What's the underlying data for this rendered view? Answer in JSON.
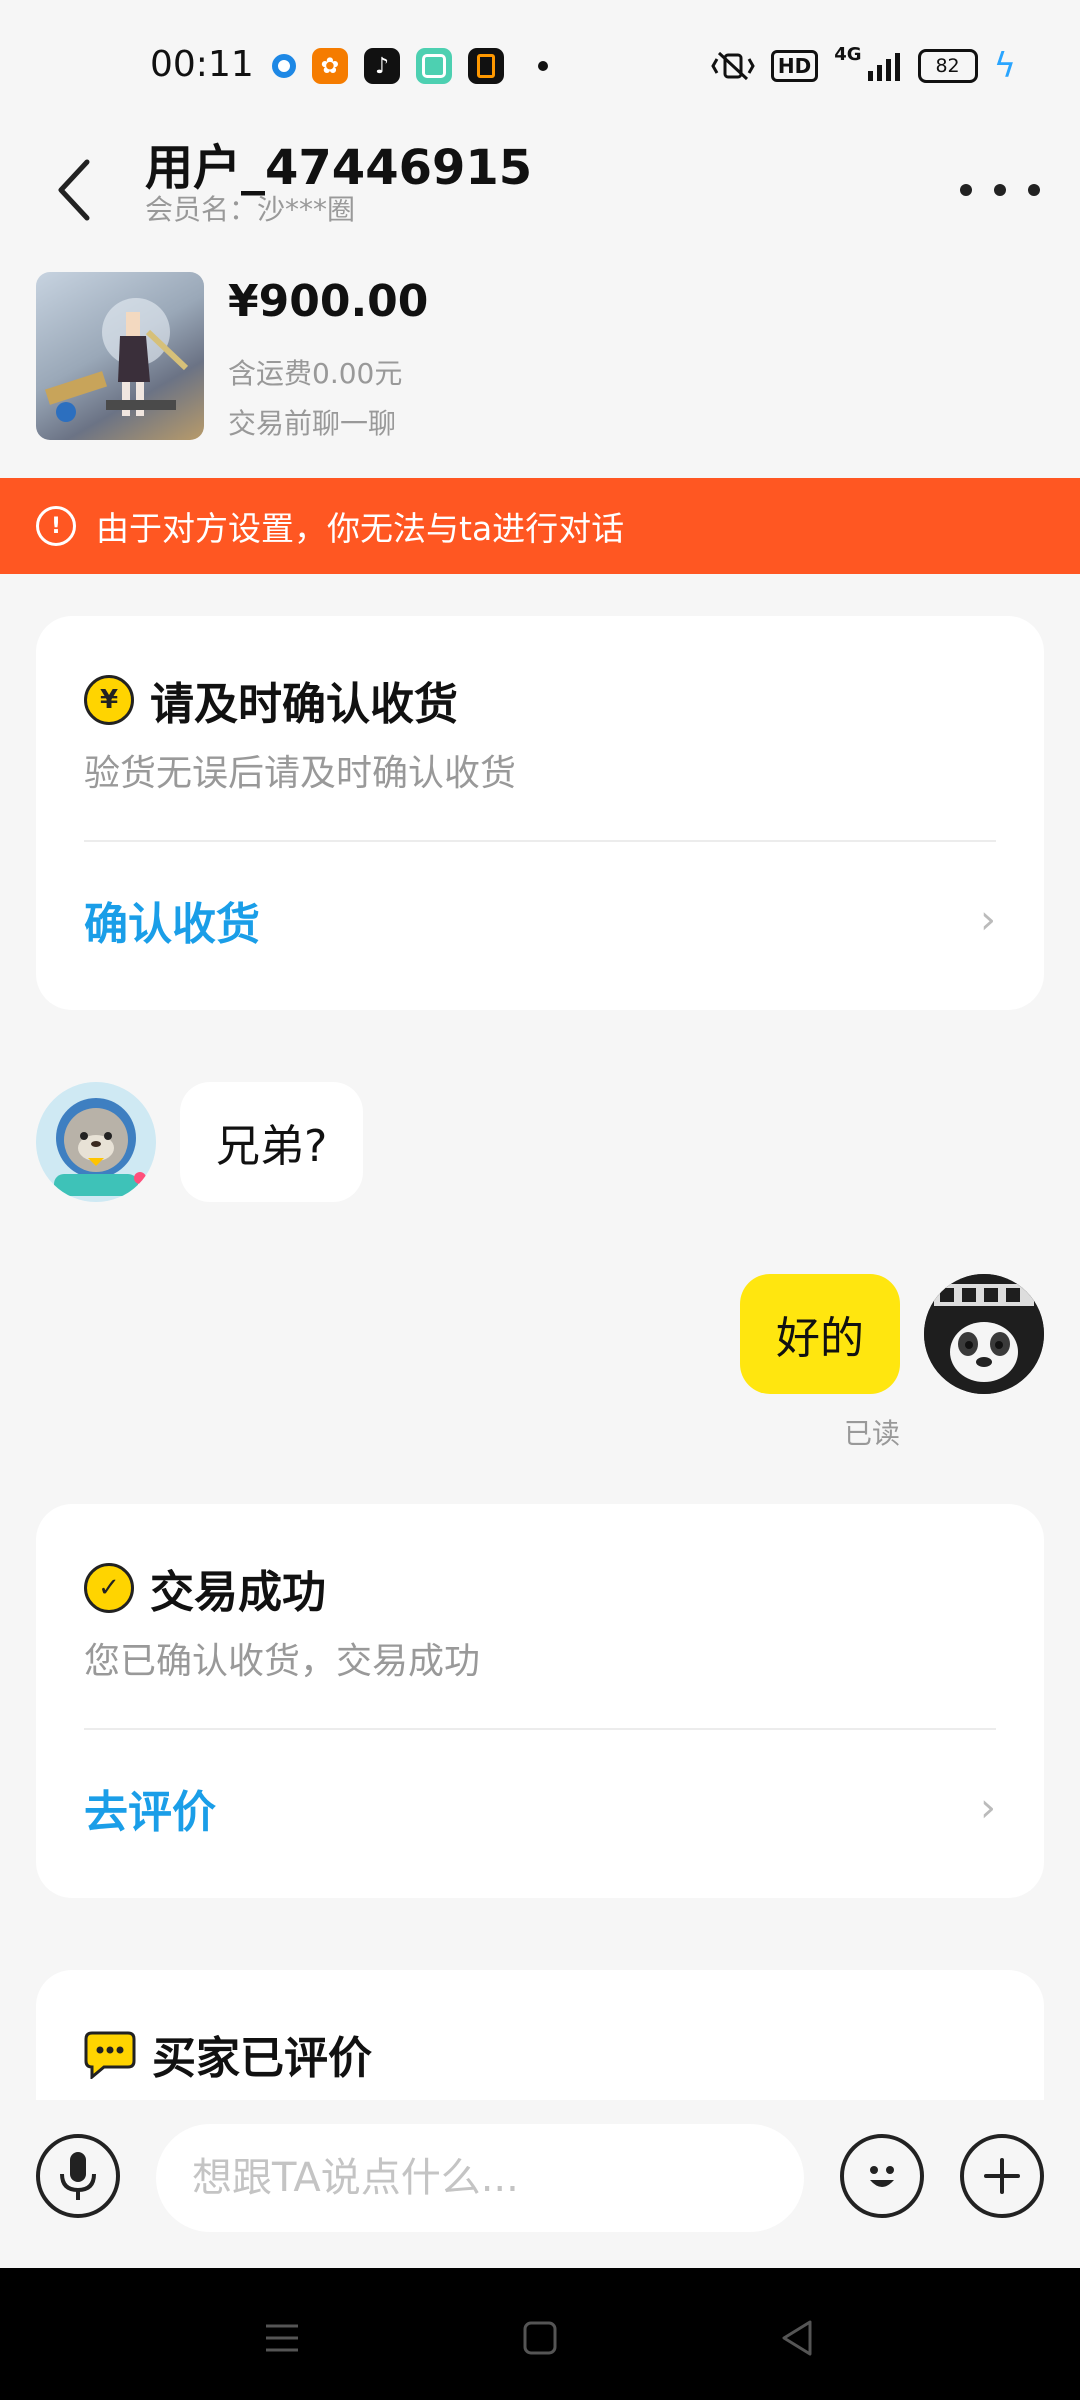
{
  "status_bar": {
    "time": "00:11",
    "network": "4G",
    "hd": "HD",
    "battery": "82"
  },
  "header": {
    "title": "用户_47446915",
    "member_name": "会员名：沙***圈"
  },
  "product": {
    "price": "¥900.00",
    "shipping": "含运费0.00元",
    "chat_hint": "交易前聊一聊"
  },
  "banner": {
    "text": "由于对方设置，你无法与ta进行对话"
  },
  "cards": {
    "confirm": {
      "icon": "yuan-coin-icon",
      "icon_glyph": "¥",
      "title": "请及时确认收货",
      "desc": "验货无误后请及时确认收货",
      "action": "确认收货"
    },
    "success": {
      "icon": "check-circle-icon",
      "icon_glyph": "✓",
      "title": "交易成功",
      "desc": "您已确认收货，交易成功",
      "action": "去评价"
    },
    "reviewed": {
      "icon": "chat-bubble-icon",
      "title": "买家已评价"
    }
  },
  "messages": {
    "incoming": "兄弟?",
    "outgoing": "好的",
    "read_status": "已读"
  },
  "input_bar": {
    "placeholder": "想跟TA说点什么..."
  },
  "colors": {
    "banner": "#ff5722",
    "accent_blue": "#1a9ee8",
    "bubble_yellow": "#ffe60f",
    "badge_yellow": "#ffd400"
  }
}
